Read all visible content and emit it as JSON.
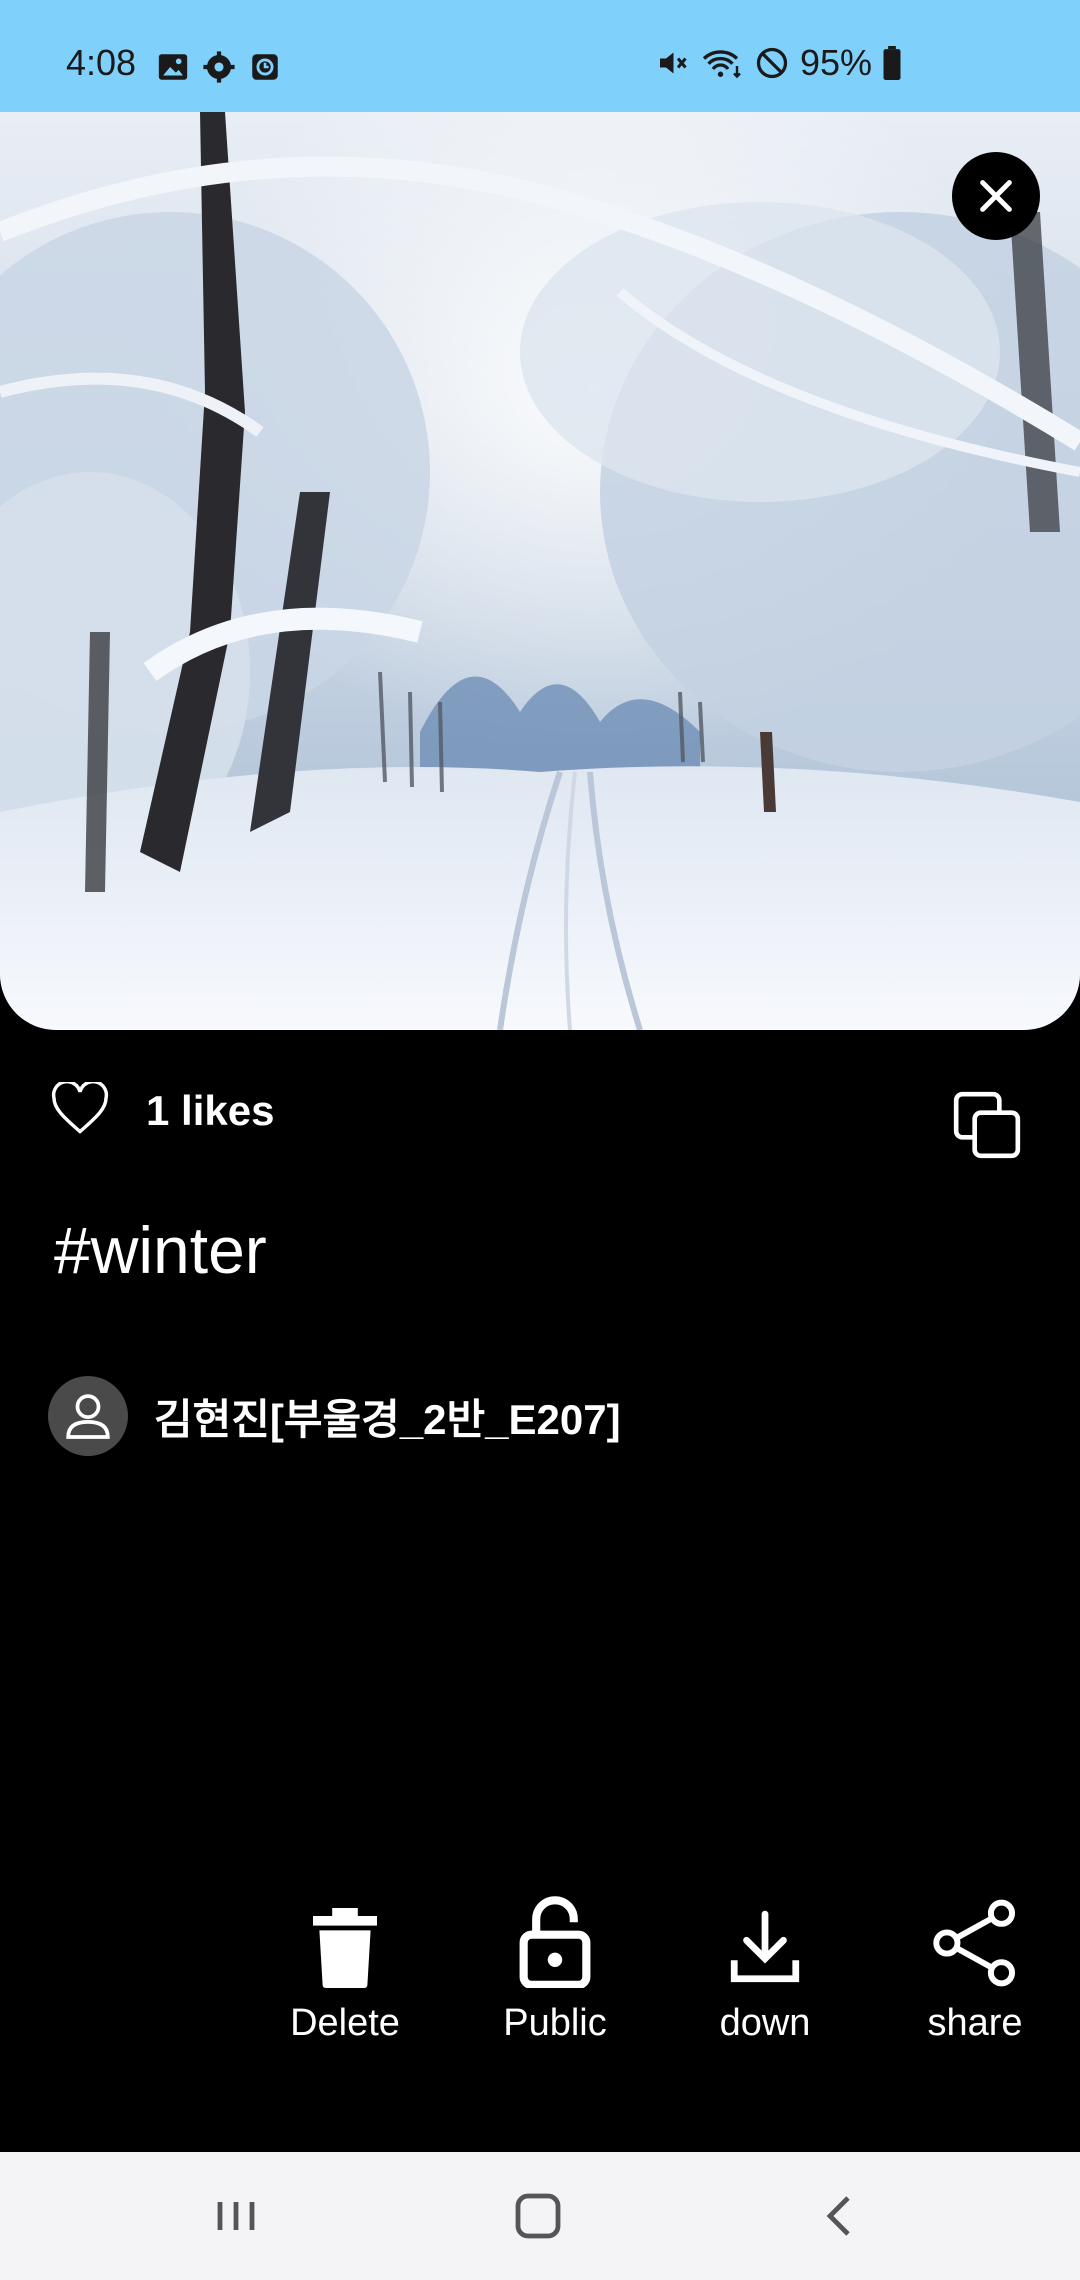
{
  "status": {
    "time": "4:08",
    "battery": "95%",
    "left_icons": [
      "gallery-icon",
      "gear-icon",
      "clock-icon"
    ],
    "right_icons": [
      "mute-icon",
      "wifi-icon",
      "do-not-disturb-icon",
      "battery-icon"
    ]
  },
  "photo": {
    "subject": "snow-covered forest path",
    "close_icon": "close-icon"
  },
  "post": {
    "likes_label": "1 likes",
    "hashtag": "#winter",
    "author": "김현진[부울경_2반_E207]"
  },
  "actions": {
    "delete_label": "Delete",
    "public_label": "Public",
    "down_label": "down",
    "share_label": "share"
  },
  "nav": {
    "items": [
      "recent-apps-icon",
      "home-icon",
      "back-icon"
    ]
  },
  "colors": {
    "status_bar": "#7fd0fb",
    "background": "#000000",
    "nav_bar": "#f4f4f6"
  }
}
